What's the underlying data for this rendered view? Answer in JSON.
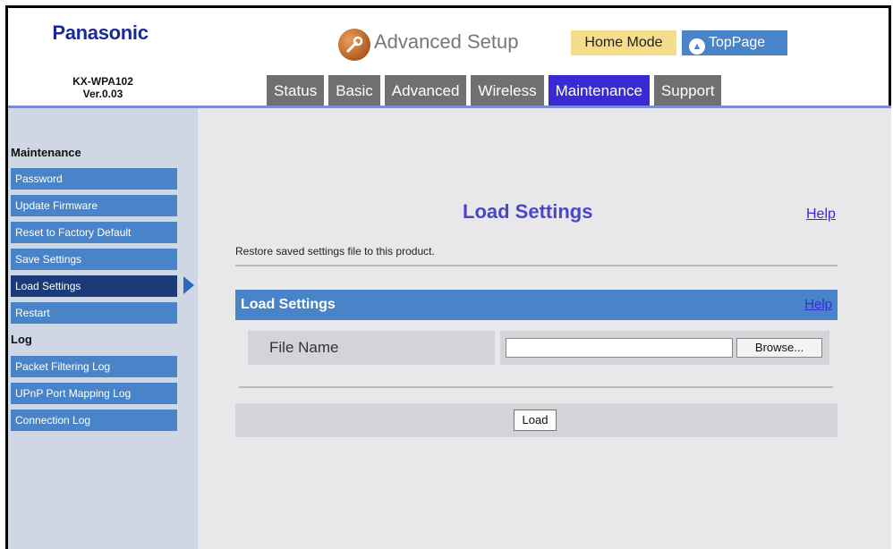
{
  "brand": {
    "name": "Panasonic",
    "model": "KX-WPA102",
    "version": "Ver.0.03"
  },
  "header": {
    "title": "Advanced Setup",
    "home_mode": "Home Mode",
    "toppage": "TopPage"
  },
  "tabs": [
    "Status",
    "Basic",
    "Advanced",
    "Wireless",
    "Maintenance",
    "Support"
  ],
  "sidebar": {
    "maintenance_heading": "Maintenance",
    "maintenance_items": [
      "Password",
      "Update Firmware",
      "Reset to Factory Default",
      "Save Settings",
      "Load Settings",
      "Restart"
    ],
    "log_heading": "Log",
    "log_items": [
      "Packet Filtering Log",
      "UPnP Port Mapping Log",
      "Connection Log"
    ]
  },
  "main": {
    "title": "Load Settings",
    "help": "Help",
    "description": "Restore saved settings file to this product.",
    "section_title": "Load Settings",
    "section_help": "Help",
    "file_label": "File Name",
    "file_value": "",
    "browse_label": "Browse...",
    "load_label": "Load"
  },
  "colors": {
    "active_tab": "#3a2ad6",
    "tab": "#707070",
    "sidebar_item": "#4a84c8",
    "sidebar_active": "#1a3a7a",
    "title": "#4a46c8"
  }
}
